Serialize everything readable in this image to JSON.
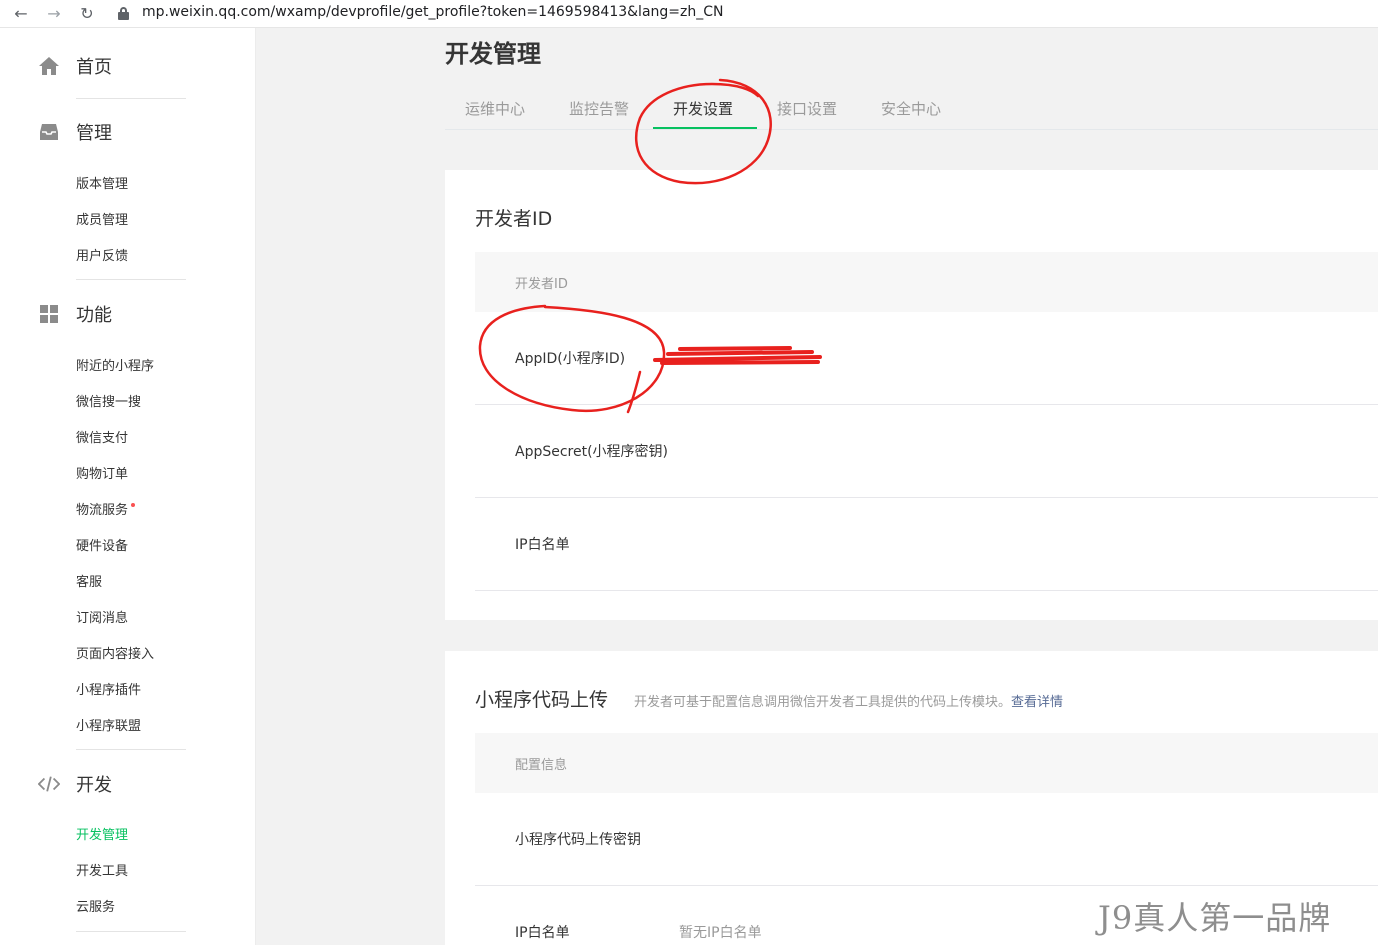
{
  "browser": {
    "back": "←",
    "forward": "→",
    "reload": "↻",
    "url": "mp.weixin.qq.com/wxamp/devprofile/get_profile?token=1469598413&lang=zh_CN"
  },
  "sidebar": {
    "home": {
      "label": "首页"
    },
    "manage": {
      "label": "管理",
      "items": [
        "版本管理",
        "成员管理",
        "用户反馈"
      ]
    },
    "features": {
      "label": "功能",
      "items": [
        "附近的小程序",
        "微信搜一搜",
        "微信支付",
        "购物订单",
        "物流服务",
        "硬件设备",
        "客服",
        "订阅消息",
        "页面内容接入",
        "小程序插件",
        "小程序联盟"
      ]
    },
    "develop": {
      "label": "开发",
      "items": [
        "开发管理",
        "开发工具",
        "云服务"
      ],
      "active": "开发管理"
    }
  },
  "main": {
    "title": "开发管理",
    "tabs": [
      "运维中心",
      "监控告警",
      "开发设置",
      "接口设置",
      "安全中心"
    ],
    "active_tab": "开发设置",
    "developer_id": {
      "title": "开发者ID",
      "header": "开发者ID",
      "rows": [
        {
          "label": "AppID(小程序ID)"
        },
        {
          "label": "AppSecret(小程序密钥)"
        },
        {
          "label": "IP白名单"
        }
      ]
    },
    "code_upload": {
      "title": "小程序代码上传",
      "desc": "开发者可基于配置信息调用微信开发者工具提供的代码上传模块。",
      "desc_link": "查看详情",
      "header": "配置信息",
      "rows": [
        {
          "label": "小程序代码上传密钥",
          "value": ""
        },
        {
          "label": "IP白名单",
          "value": "暂无IP白名单"
        }
      ]
    }
  },
  "watermark": "J9真人第一品牌",
  "colors": {
    "accent": "#07c160",
    "link": "#576b95",
    "annotation": "#e8211e",
    "badge": "#fa5151"
  }
}
